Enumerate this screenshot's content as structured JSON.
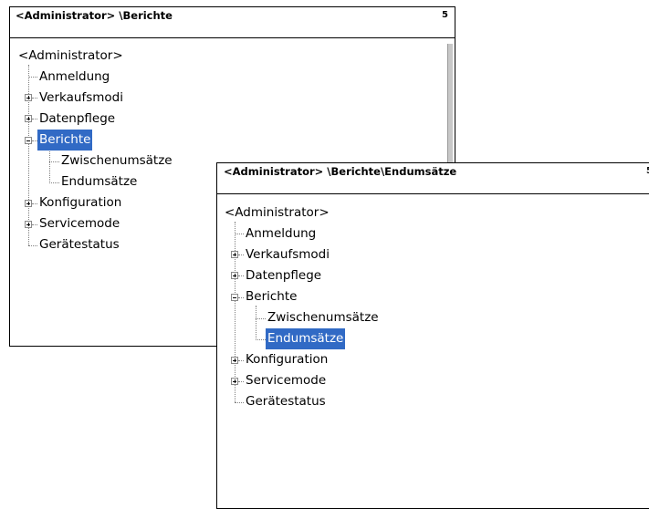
{
  "window1": {
    "title": "<Administrator> \\Berichte",
    "number": "5",
    "root": "<Administrator>",
    "items": {
      "anmeldung": "Anmeldung",
      "verkaufsmodi": "Verkaufsmodi",
      "datenpflege": "Datenpflege",
      "berichte": "Berichte",
      "zwischenumsaetze": "Zwischenumsätze",
      "endumsaetze": "Endumsätze",
      "konfiguration": "Konfiguration",
      "servicemode": "Servicemode",
      "geraetestatus": "Gerätestatus"
    },
    "selected": "Berichte"
  },
  "window2": {
    "title": "<Administrator> \\Berichte\\Endumsätze",
    "number": "5",
    "root": "<Administrator>",
    "items": {
      "anmeldung": "Anmeldung",
      "verkaufsmodi": "Verkaufsmodi",
      "datenpflege": "Datenpflege",
      "berichte": "Berichte",
      "zwischenumsaetze": "Zwischenumsätze",
      "endumsaetze": "Endumsätze",
      "konfiguration": "Konfiguration",
      "servicemode": "Servicemode",
      "geraetestatus": "Gerätestatus"
    },
    "selected": "Endumsätze"
  },
  "colors": {
    "selection": "#316ac5",
    "border": "#000000",
    "tree_lines": "#808080"
  }
}
